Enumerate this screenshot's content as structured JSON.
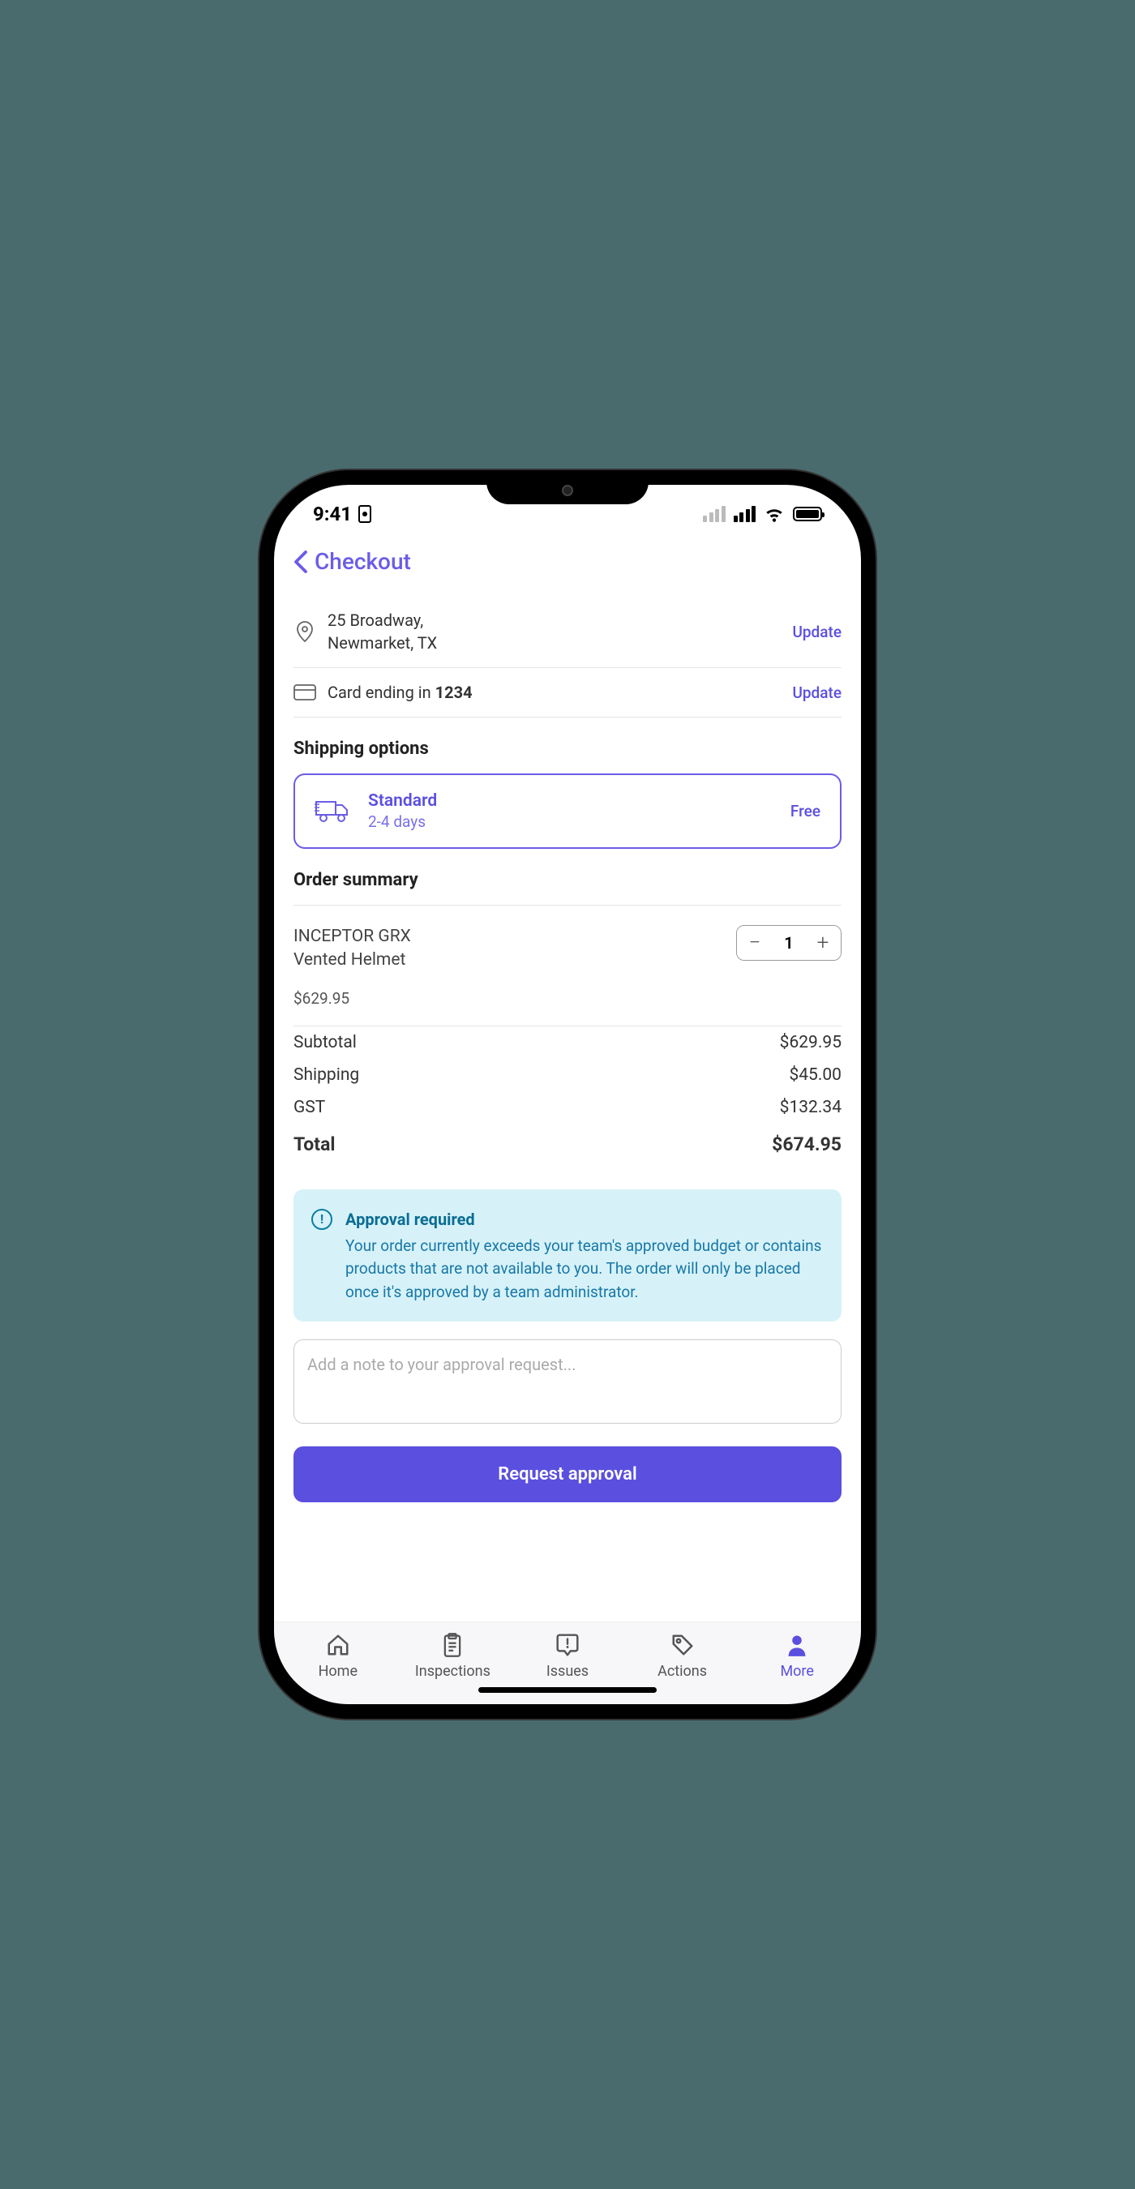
{
  "status": {
    "time": "9:41"
  },
  "nav": {
    "title": "Checkout"
  },
  "address": {
    "line1": "25 Broadway,",
    "line2": "Newmarket, TX",
    "update_label": "Update"
  },
  "payment": {
    "prefix": "Card ending in ",
    "last4": "1234",
    "update_label": "Update"
  },
  "shipping": {
    "heading": "Shipping options",
    "option": {
      "name": "Standard",
      "duration": "2-4 days",
      "price": "Free"
    }
  },
  "order": {
    "heading": "Order summary",
    "item": {
      "line1": "INCEPTOR GRX",
      "line2": "Vented Helmet",
      "qty": "1",
      "price": "$629.95"
    },
    "subtotal_label": "Subtotal",
    "subtotal_value": "$629.95",
    "shipping_label": "Shipping",
    "shipping_value": "$45.00",
    "gst_label": "GST",
    "gst_value": "$132.34",
    "total_label": "Total",
    "total_value": "$674.95"
  },
  "approval": {
    "title": "Approval required",
    "body": "Your order currently exceeds your team's approved budget or contains products that are not available to you. The order will only be placed once it's approved by a team administrator."
  },
  "note": {
    "placeholder": "Add a note to your approval request..."
  },
  "cta": {
    "label": "Request approval"
  },
  "tabs": {
    "home": "Home",
    "inspections": "Inspections",
    "issues": "Issues",
    "actions": "Actions",
    "more": "More"
  }
}
